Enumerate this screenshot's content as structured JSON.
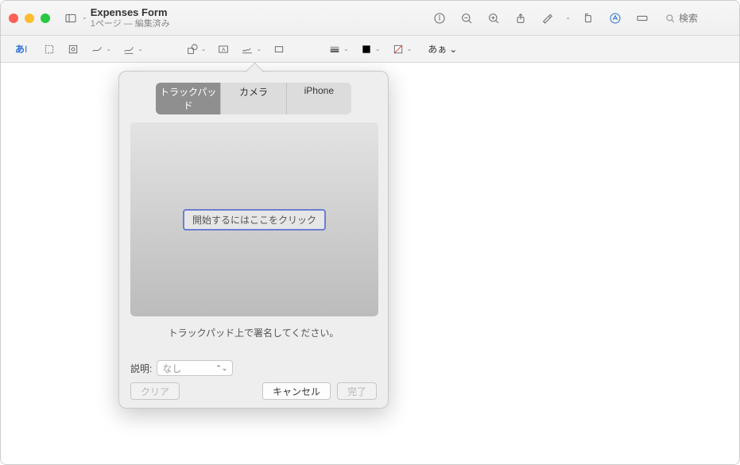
{
  "titlebar": {
    "doc_title": "Expenses Form",
    "doc_subtitle": "1ページ — 編集済み",
    "search_placeholder": "検索"
  },
  "toolbar2": {
    "text_insert": "あ",
    "font_menu": "あぁ"
  },
  "popover": {
    "tabs": {
      "trackpad": "トラックパッド",
      "camera": "カメラ",
      "iphone": "iPhone"
    },
    "start_label": "開始するにはここをクリック",
    "instruction": "トラックパッド上で署名してください。",
    "desc_label": "説明:",
    "desc_value": "なし",
    "clear": "クリア",
    "cancel": "キャンセル",
    "done": "完了"
  }
}
